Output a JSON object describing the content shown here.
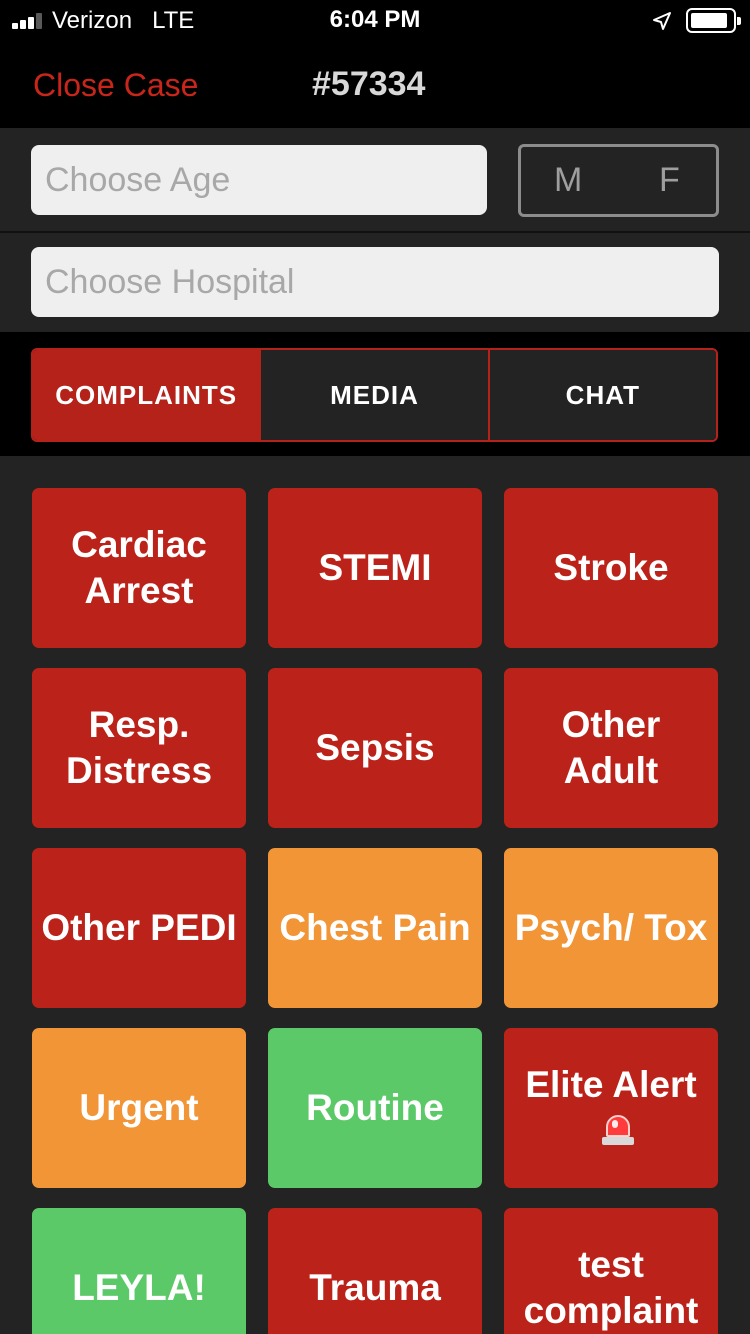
{
  "status_bar": {
    "carrier": "Verizon",
    "network": "LTE",
    "time": "6:04 PM",
    "signal_bars": 3,
    "battery_level": 0.9
  },
  "nav": {
    "close_label": "Close Case",
    "case_number": "#57334"
  },
  "form": {
    "age_placeholder": "Choose Age",
    "sex_options": [
      "M",
      "F"
    ],
    "hospital_placeholder": "Choose Hospital"
  },
  "tabs": [
    {
      "label": "COMPLAINTS",
      "active": true
    },
    {
      "label": "MEDIA",
      "active": false
    },
    {
      "label": "CHAT",
      "active": false
    }
  ],
  "colors": {
    "red": "#bb2219",
    "orange": "#f19536",
    "green": "#5cc968",
    "background": "#232323"
  },
  "complaints": [
    {
      "label": "Cardiac Arrest",
      "color": "#bb2219"
    },
    {
      "label": "STEMI",
      "color": "#bb2219"
    },
    {
      "label": "Stroke",
      "color": "#bb2219"
    },
    {
      "label": "Resp. Distress",
      "color": "#bb2219"
    },
    {
      "label": "Sepsis",
      "color": "#bb2219"
    },
    {
      "label": "Other Adult",
      "color": "#bb2219"
    },
    {
      "label": "Other PEDI",
      "color": "#bb2219"
    },
    {
      "label": "Chest Pain",
      "color": "#f19536"
    },
    {
      "label": "Psych/ Tox",
      "color": "#f19536"
    },
    {
      "label": "Urgent",
      "color": "#f19536"
    },
    {
      "label": "Routine",
      "color": "#5cc968"
    },
    {
      "label": "Elite Alert",
      "color": "#bb2219",
      "icon": "siren-icon"
    },
    {
      "label": "LEYLA!",
      "color": "#5cc968"
    },
    {
      "label": "Trauma",
      "color": "#bb2219"
    },
    {
      "label": "test complaint",
      "color": "#bb2219"
    }
  ]
}
